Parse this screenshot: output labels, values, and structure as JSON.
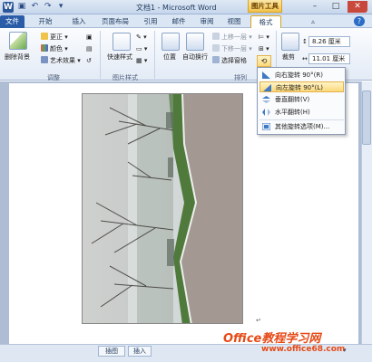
{
  "window": {
    "title": "文档1 - Microsoft Word",
    "contextual_tab_group": "图片工具"
  },
  "tabs": [
    "文件",
    "开始",
    "插入",
    "页面布局",
    "引用",
    "邮件",
    "审阅",
    "视图",
    "格式"
  ],
  "ribbon": {
    "remove_bg_label": "删除背景",
    "correct_label": "更正",
    "color_label": "颜色",
    "artistic_label": "艺术效果",
    "adjust_group": "调整",
    "quick_styles_label": "快速样式",
    "picture_styles_group": "图片样式",
    "position_label": "位置",
    "wrap_label": "自动换行",
    "bring_forward_label": "上移一层",
    "send_backward_label": "下移一层",
    "selection_pane_label": "选择窗格",
    "arrange_group": "排列",
    "crop_label": "裁剪",
    "height_value": "8.26 厘米",
    "width_value": "11.01 厘米"
  },
  "rotate_menu": {
    "items": [
      {
        "label": "向右旋转 90°(R)"
      },
      {
        "label": "向左旋转 90°(L)"
      },
      {
        "label": "垂直翻转(V)"
      },
      {
        "label": "水平翻转(H)"
      },
      {
        "label": "其他旋转选项(M)..."
      }
    ],
    "highlighted_index": 1
  },
  "status": {
    "mode1": "插图",
    "mode2": "插入"
  },
  "watermark": {
    "line1": "Office教程学习网",
    "line2": "www.office68.com"
  },
  "colors": {
    "file_tab": "#2a5ca8",
    "tools_tab": "#f2c24e",
    "highlight": "#fcd97a",
    "watermark": "#e64a17"
  }
}
